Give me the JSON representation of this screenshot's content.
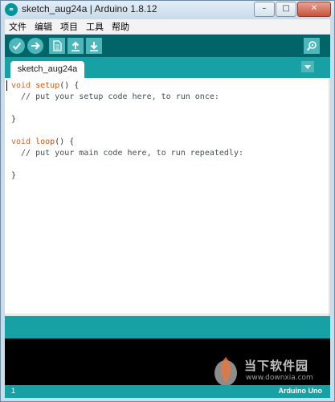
{
  "window": {
    "title": "sketch_aug24a | Arduino 1.8.12",
    "logo_text": "∞",
    "minimize_glyph": "–",
    "maximize_glyph": "□",
    "close_glyph": "✕"
  },
  "menu": {
    "items": [
      {
        "label": "文件"
      },
      {
        "label": "编辑"
      },
      {
        "label": "项目"
      },
      {
        "label": "工具"
      },
      {
        "label": "帮助"
      }
    ]
  },
  "toolbar": {
    "buttons": [
      {
        "icon": "verify-check-icon"
      },
      {
        "icon": "upload-arrow-icon"
      },
      {
        "icon": "new-sketch-icon"
      },
      {
        "icon": "open-sketch-icon"
      },
      {
        "icon": "save-sketch-icon"
      },
      {
        "icon": "serial-monitor-icon"
      }
    ]
  },
  "tabs": {
    "active": "sketch_aug24a",
    "menu_icon": "chevron-down-icon"
  },
  "code": {
    "l1_kw": "void",
    "l1_fn": "setup",
    "l1_rest": "() {",
    "l2": "  // put your setup code here, to run once:",
    "l4": "}",
    "l6_kw": "void",
    "l6_fn": "loop",
    "l6_rest": "() {",
    "l7": "  // put your main code here, to run repeatedly:",
    "l9": "}"
  },
  "status": {
    "line": "1",
    "board": "Arduino Uno"
  },
  "watermark": {
    "text": "当下软件园",
    "url": "www.downxia.com"
  },
  "colors": {
    "teal_dark": "#006468",
    "teal": "#17a1a5",
    "button": "#4db7bb",
    "keyword": "#cc6633",
    "function": "#d35400"
  }
}
